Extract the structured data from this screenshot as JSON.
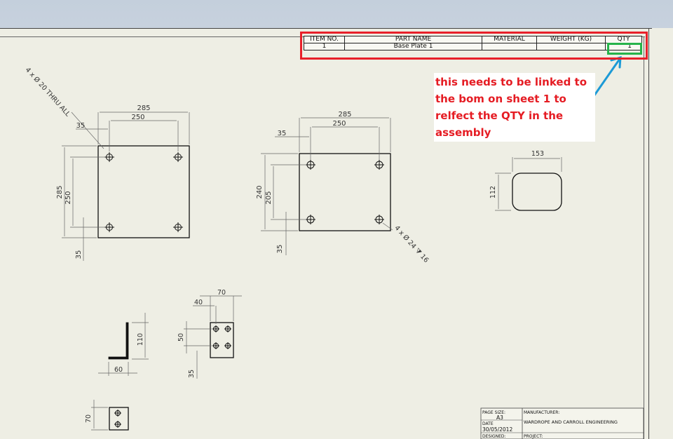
{
  "bom": {
    "headers": [
      "ITEM NO.",
      "PART NAME",
      "MATERIAL",
      "WEIGHT (KG)",
      "QTY"
    ],
    "rows": [
      {
        "item_no": "1",
        "part_name": "Base Plate 1",
        "material": "",
        "weight": "",
        "qty": "1"
      }
    ]
  },
  "annotation": {
    "text": "this needs to be linked to the bom on sheet 1 to relfect the QTY in the assembly",
    "color": "#e51c23",
    "arrow_color": "#1c9ad6"
  },
  "highlight_colors": {
    "bom_box": "#e8202a",
    "qty_box": "#26b34a"
  },
  "views": {
    "plate1": {
      "dims": {
        "overall_width": "285",
        "hole_width": "250",
        "edge_offset": "35",
        "overall_height": "285",
        "hole_height": "250",
        "bottom_offset": "35"
      },
      "hole_callout": "4 x Ø 20 THRU ALL"
    },
    "plate2": {
      "dims": {
        "overall_width": "285",
        "hole_width": "250",
        "edge_offset": "35",
        "overall_height": "240",
        "hole_height": "205",
        "bottom_offset": "35"
      },
      "hole_callout": "4 x Ø 24 ⧩ 16"
    },
    "slot": {
      "dims": {
        "width": "153",
        "height": "112"
      }
    },
    "angle_side": {
      "dims": {
        "height": "110",
        "width": "60"
      }
    },
    "angle_front": {
      "dims": {
        "width": "70",
        "offset": "40",
        "hole_spacing": "50",
        "bottom_offset": "35"
      }
    },
    "small_part": {
      "dims": {
        "height": "70"
      }
    }
  },
  "title_block": {
    "page_size_label": "PAGE SIZE:",
    "page_size": "A3",
    "date_label": "DATE",
    "date": "30/05/2012",
    "designed_label": "DESIGNED:",
    "manufacturer_label": "MANUFACTURER:",
    "manufacturer": "WARDROPE AND CARROLL ENGINEERING",
    "project_label": "PROJECT:"
  }
}
